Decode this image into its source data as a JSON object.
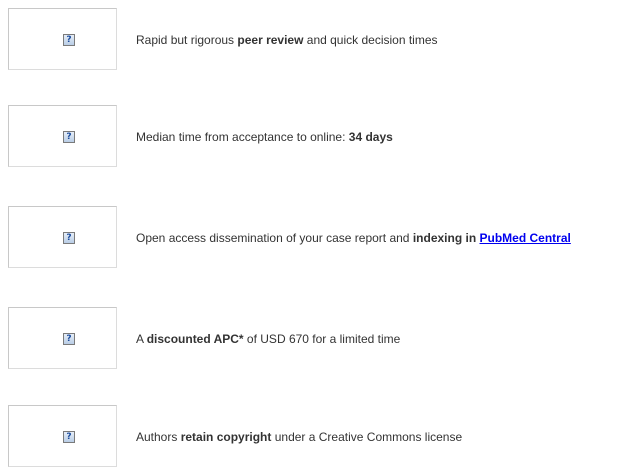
{
  "features": [
    {
      "icon": "broken-image-icon",
      "parts": [
        {
          "t": "Rapid but rigorous ",
          "b": false
        },
        {
          "t": "peer review",
          "b": true
        },
        {
          "t": " and quick decision times",
          "b": false
        }
      ]
    },
    {
      "icon": "broken-image-icon",
      "parts": [
        {
          "t": "Median time from acceptance to online: ",
          "b": false
        },
        {
          "t": "34 days",
          "b": true
        }
      ]
    },
    {
      "icon": "broken-image-icon",
      "parts": [
        {
          "t": "Open access dissemination of your case report and ",
          "b": false
        },
        {
          "t": "indexing in ",
          "b": true
        },
        {
          "t": "PubMed Central",
          "b": true,
          "link": true
        }
      ]
    },
    {
      "icon": "broken-image-icon",
      "parts": [
        {
          "t": "A ",
          "b": false
        },
        {
          "t": "discounted APC*",
          "b": true
        },
        {
          "t": " of USD 670 for a limited time",
          "b": false
        }
      ]
    },
    {
      "icon": "broken-image-icon",
      "parts": [
        {
          "t": "Authors ",
          "b": false
        },
        {
          "t": "retain copyright",
          "b": true
        },
        {
          "t": " under a Creative Commons license",
          "b": false
        }
      ]
    }
  ],
  "broken_image_glyph": "?",
  "colors": {
    "text": "#333333",
    "link": "#0000ee",
    "image_border": "#c8c8c8"
  }
}
